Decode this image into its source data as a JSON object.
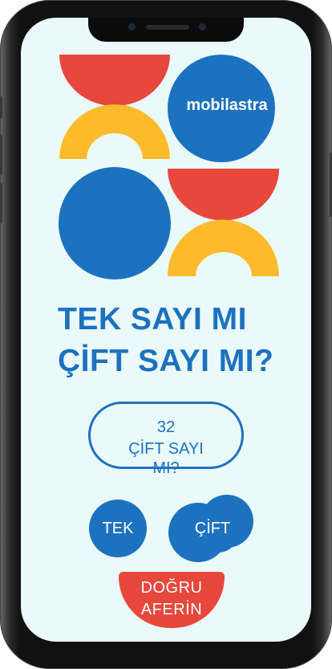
{
  "brand": {
    "logo_text": "mobilastra"
  },
  "title": {
    "line1": "TEK SAYI MI",
    "line2": "ÇİFT SAYI MI?"
  },
  "question": {
    "number": "32",
    "text_line1": "ÇİFT SAYI",
    "text_line2": "MI?"
  },
  "answers": {
    "odd_label": "TEK",
    "even_label": "ÇİFT"
  },
  "feedback": {
    "line1": "DOĞRU",
    "line2": "AFERİN"
  },
  "icons": [
    "front-camera-icon",
    "speaker-grille-icon"
  ],
  "colors": {
    "primary_blue": "#1c72bf",
    "red": "#e8473c",
    "yellow": "#fdbb2c",
    "screen_bg": "#eafafb"
  }
}
